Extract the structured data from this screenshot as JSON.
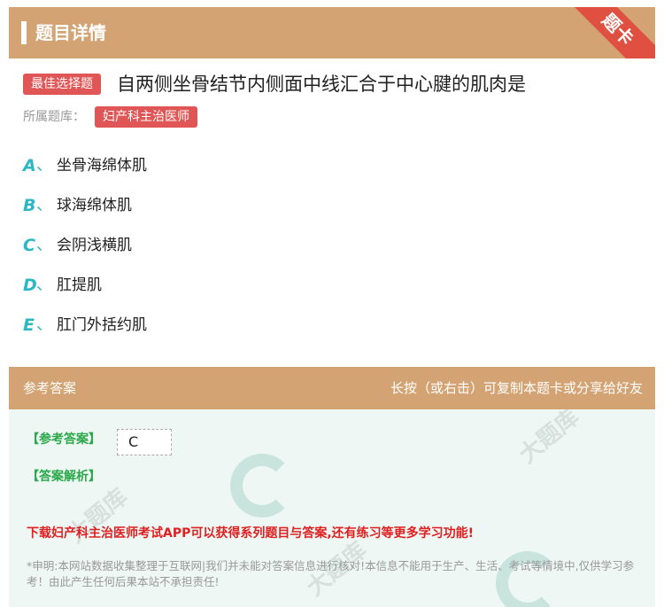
{
  "header": {
    "title": "题目详情",
    "corner_badge": "题卡"
  },
  "question": {
    "type_tag": "最佳选择题",
    "text": "自两侧坐骨结节内侧面中线汇合于中心腱的肌肉是",
    "bank_label": "所属题库：",
    "bank_name": "妇产科主治医师"
  },
  "options": [
    {
      "letter": "A",
      "sep": "、",
      "text": "坐骨海绵体肌"
    },
    {
      "letter": "B",
      "sep": "、",
      "text": "球海绵体肌"
    },
    {
      "letter": "C",
      "sep": "、",
      "text": "会阴浅横肌"
    },
    {
      "letter": "D",
      "sep": "、",
      "text": "肛提肌"
    },
    {
      "letter": "E",
      "sep": "、",
      "text": "肛门外括约肌"
    }
  ],
  "answer_section": {
    "title": "参考答案",
    "hint": "长按（或右击）可复制本题卡或分享给好友",
    "answer_label": "【参考答案】",
    "answer_value": "C",
    "explain_label": "【答案解析】",
    "download_text": "下载妇产科主治医师考试APP可以获得系列题目与答案,还有练习等更多学习功能!",
    "disclaimer": "*申明:本网站数据收集整理于互联网|我们并未能对答案信息进行核对!本信息不能用于生产、生活、考试等情境中,仅供学习参考！由此产生任何后果本站不承担责任!"
  },
  "colors": {
    "header_bg": "#d4a373",
    "tag_red": "#e05555",
    "option_letter": "#2bb8c4",
    "answer_green": "#2aa84a",
    "download_red": "#e02020"
  },
  "watermark": {
    "text": "大题库"
  }
}
